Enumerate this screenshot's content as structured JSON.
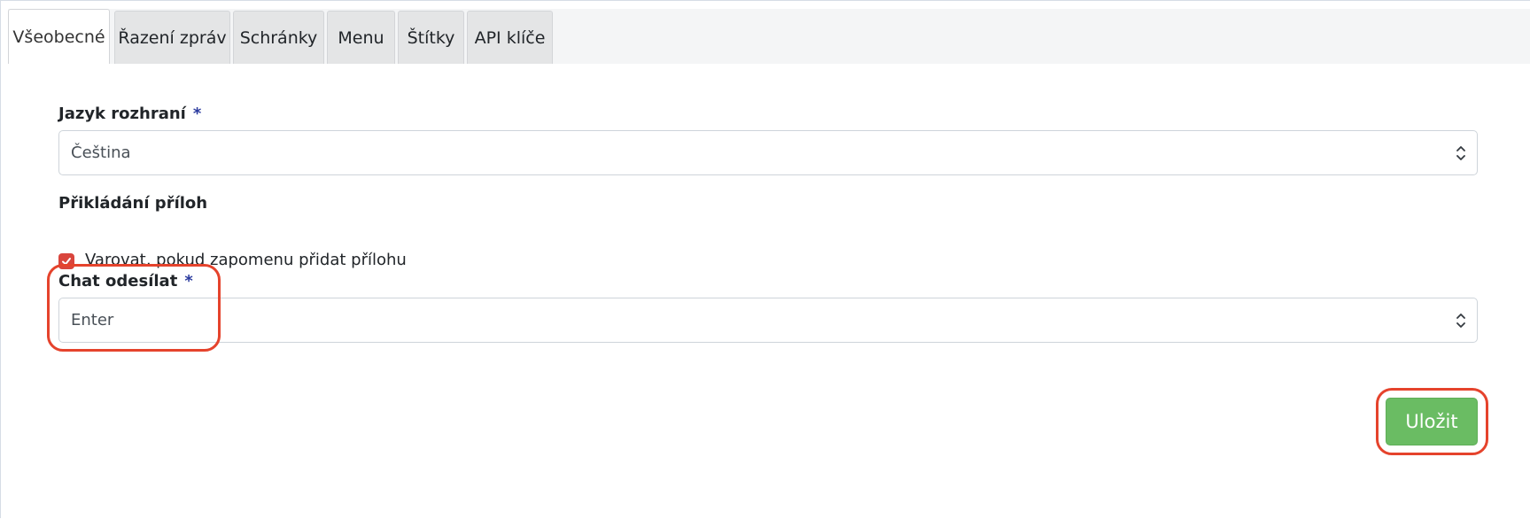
{
  "tabs": [
    {
      "label": "Všeobecné",
      "active": true
    },
    {
      "label": "Řazení zpráv",
      "active": false
    },
    {
      "label": "Schránky",
      "active": false
    },
    {
      "label": "Menu",
      "active": false
    },
    {
      "label": "Štítky",
      "active": false
    },
    {
      "label": "API klíče",
      "active": false
    }
  ],
  "form": {
    "language": {
      "label": "Jazyk rozhraní",
      "required_mark": "*",
      "value": "Čeština"
    },
    "attachments": {
      "label": "Přikládání příloh",
      "checkbox_label": "Varovat, pokud zapomenu přidat přílohu",
      "checked": true
    },
    "chat_send": {
      "label": "Chat odesílat",
      "required_mark": "*",
      "value": "Enter"
    },
    "save_label": "Uložit"
  },
  "colors": {
    "accent_green": "#6abc63",
    "checkbox_red": "#d9453d",
    "highlight_red": "#e5432c",
    "required_blue": "#2a3a9e"
  },
  "icons": {
    "select_chevron": "chevron-up-down-icon",
    "checkbox_check": "check-icon"
  }
}
